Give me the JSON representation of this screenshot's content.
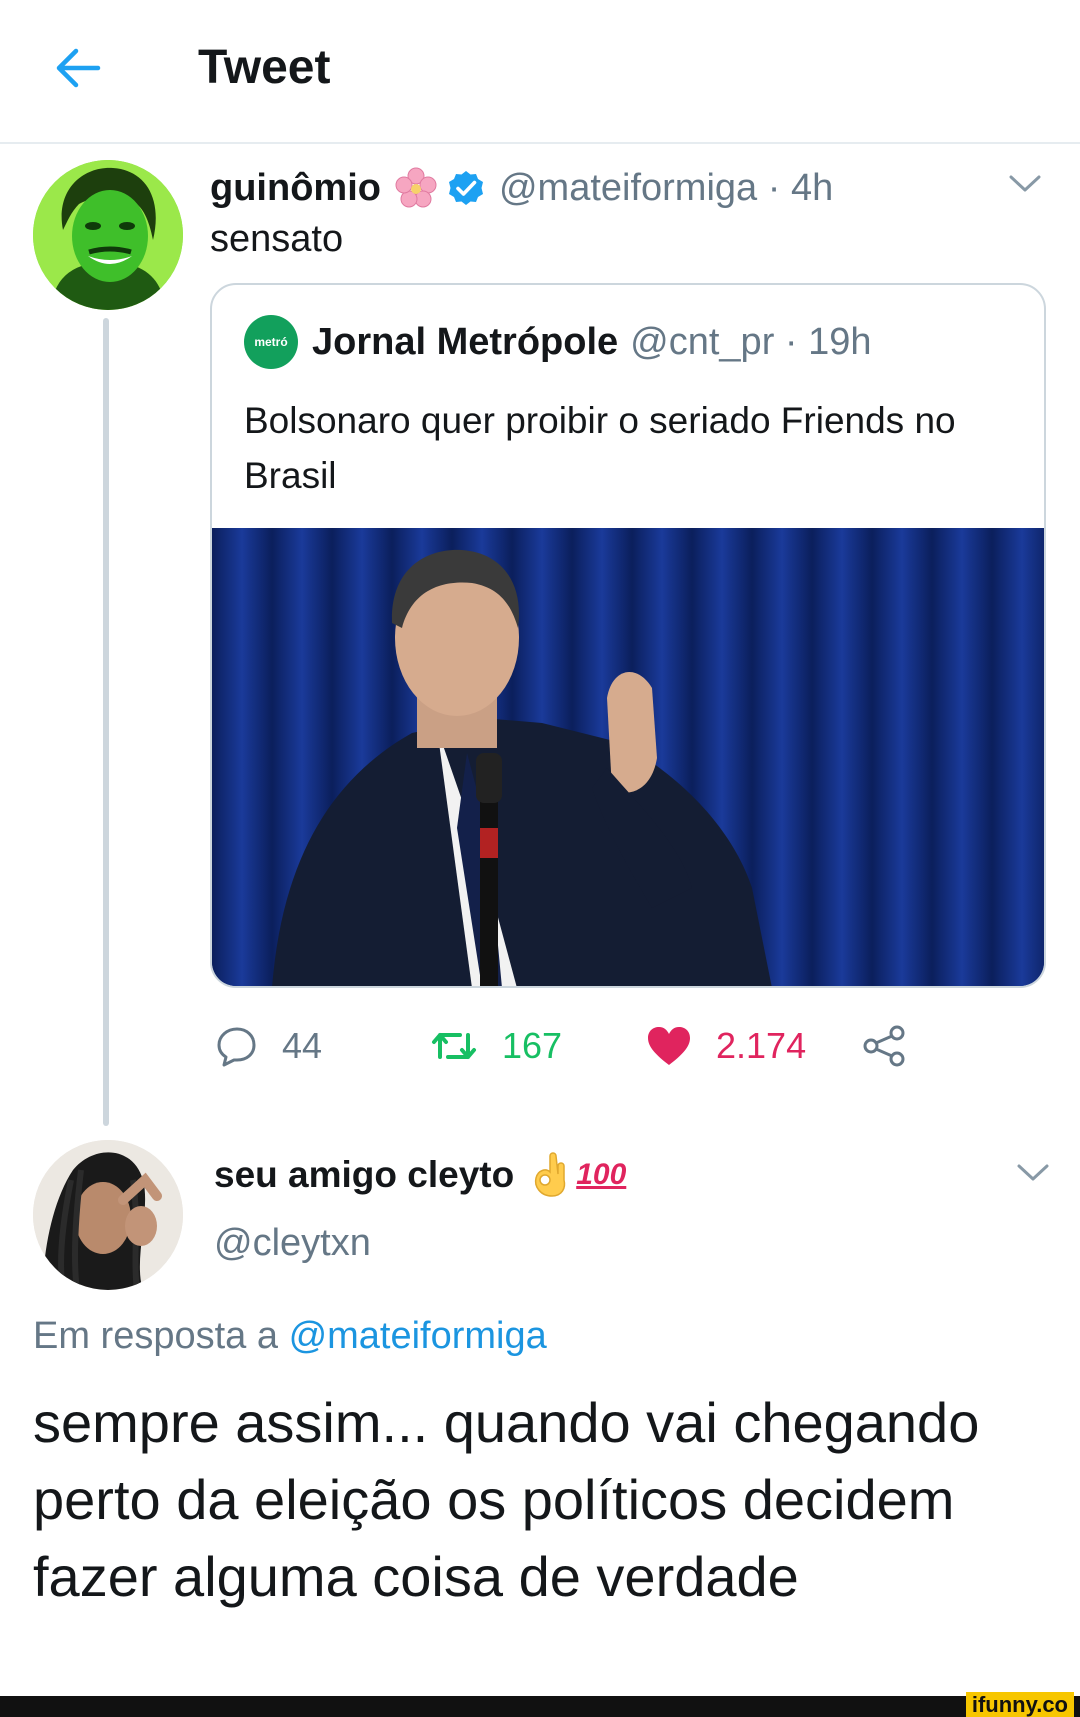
{
  "header": {
    "title": "Tweet"
  },
  "tweet": {
    "display_name": "guinômio",
    "handle": "@mateiformiga",
    "separator": " · ",
    "time": "4h",
    "text": "sensato",
    "quote": {
      "logo_text": "metró",
      "display_name": "Jornal Metrópole",
      "handle": "@cnt_pr",
      "separator": " · ",
      "time": "19h",
      "text": "Bolsonaro quer proibir o seriado Friends no Brasil"
    },
    "actions": {
      "replies": "44",
      "retweets": "167",
      "likes": "2.174"
    },
    "colors": {
      "retweet": "#17bf63",
      "like": "#e0245e",
      "link": "#1b95e0"
    }
  },
  "reply": {
    "display_name": "seu amigo cleyto",
    "badge_100": "100",
    "handle": "@cleytxn",
    "reply_prefix": "Em resposta a ",
    "reply_to": "@mateiformiga",
    "text": "sempre assim... quando vai chegando perto da eleição os políticos decidem fazer alguma coisa de verdade"
  },
  "watermark": "ifunny.co"
}
